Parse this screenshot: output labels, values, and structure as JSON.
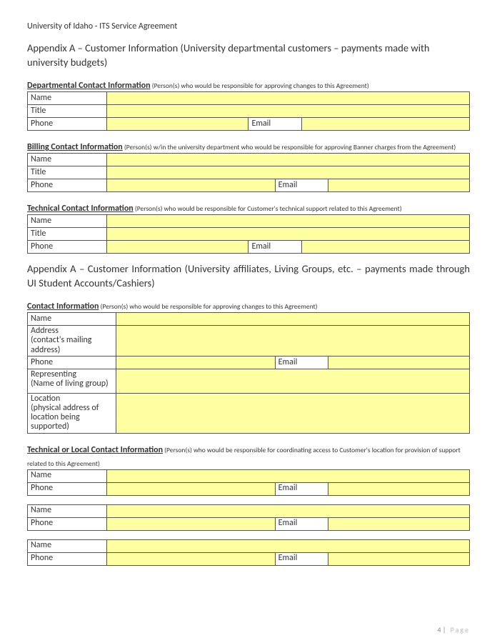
{
  "header": "University of Idaho - ITS Service Agreement",
  "sectionA_title": "Appendix A – Customer Information (University departmental customers – payments made with university budgets)",
  "dept": {
    "heading": "Departmental Contact Information",
    "note": " (Person(s) who would be responsible for approving changes to this Agreement)",
    "rows": {
      "name": "Name",
      "title": "Title",
      "phone": "Phone",
      "email": "Email"
    }
  },
  "billing": {
    "heading": "Billing Contact Information",
    "note": " (Person(s) w/in the university department who would be responsible for approving Banner charges from the Agreement)",
    "rows": {
      "name": "Name",
      "title": "Title",
      "phone": "Phone",
      "email": "Email"
    }
  },
  "tech": {
    "heading": "Technical Contact Information",
    "note": " (Person(s) who would be responsible for Customer's technical support related to this Agreement)",
    "rows": {
      "name": "Name",
      "title": "Title",
      "phone": "Phone",
      "email": "Email"
    }
  },
  "sectionB_title": "Appendix A – Customer Information (University affiliates, Living Groups, etc. – payments made through UI Student Accounts/Cashiers)",
  "contact": {
    "heading": "Contact Information",
    "note": " (Person(s) who would be responsible for approving changes to this Agreement)",
    "rows": {
      "name": "Name",
      "address": "Address",
      "address_sub": "(contact's mailing address)",
      "phone": "Phone",
      "email": "Email",
      "rep": "Representing",
      "rep_sub": "(Name of living group)",
      "loc": "Location",
      "loc_sub": "(physical address of location being supported)"
    }
  },
  "techlocal": {
    "heading": "Technical or Local Contact Information",
    "note": " (Person(s) who would be responsible for coordinating access to Customer's location for provision of support related to this Agreement)",
    "rows": {
      "name": "Name",
      "phone": "Phone",
      "email": "Email"
    }
  },
  "footer": {
    "num": "4",
    "label": "Page"
  }
}
